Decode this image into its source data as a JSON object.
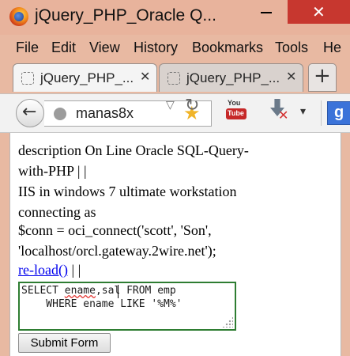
{
  "window": {
    "title": "jQuery_PHP_Oracle Q...",
    "minimize_glyph": "—",
    "close_glyph": "✕",
    "icon": "firefox-icon"
  },
  "menu": [
    "File",
    "Edit",
    "View",
    "History",
    "Bookmarks",
    "Tools",
    "He"
  ],
  "tabs": [
    {
      "label": "jQuery_PHP_...",
      "active": true,
      "close": "✕"
    },
    {
      "label": "jQuery_PHP_...",
      "active": false,
      "close": "✕"
    }
  ],
  "new_tab_label": "+",
  "nav": {
    "back_glyph": "←",
    "url": "manas8x",
    "star_glyph": "★",
    "dropdown_glyph": "▽",
    "reload_glyph": "↻",
    "youtube_label": "You Tube",
    "youtube_top": "You",
    "youtube_box": "Tube",
    "download_x_glyph": "✕",
    "download_dropdown_glyph": "▾",
    "search_engine_glyph": "g"
  },
  "page": {
    "lines": [
      "description On Line Oracle SQL-Query-",
      "with-PHP | |",
      "IIS in windows 7 ultimate workstation",
      "connecting as",
      "$conn = oci_connect('scott', 'Son',",
      "'localhost/orcl.gateway.2wire.net');"
    ],
    "reload_link": "re-load()",
    "reload_suffix": " | |",
    "sql": {
      "line1_prefix": "SELECT ",
      "line1_misspelled": "ename",
      "line1_rest": ",sal FROM emp",
      "line2": "    WHERE ename LIKE '%M%'"
    },
    "submit_label": "Submit Form"
  },
  "colors": {
    "chrome": "#e8b9a2",
    "close_button": "#c7372f",
    "sql_border": "#2e7d32",
    "link": "#0000ee"
  }
}
